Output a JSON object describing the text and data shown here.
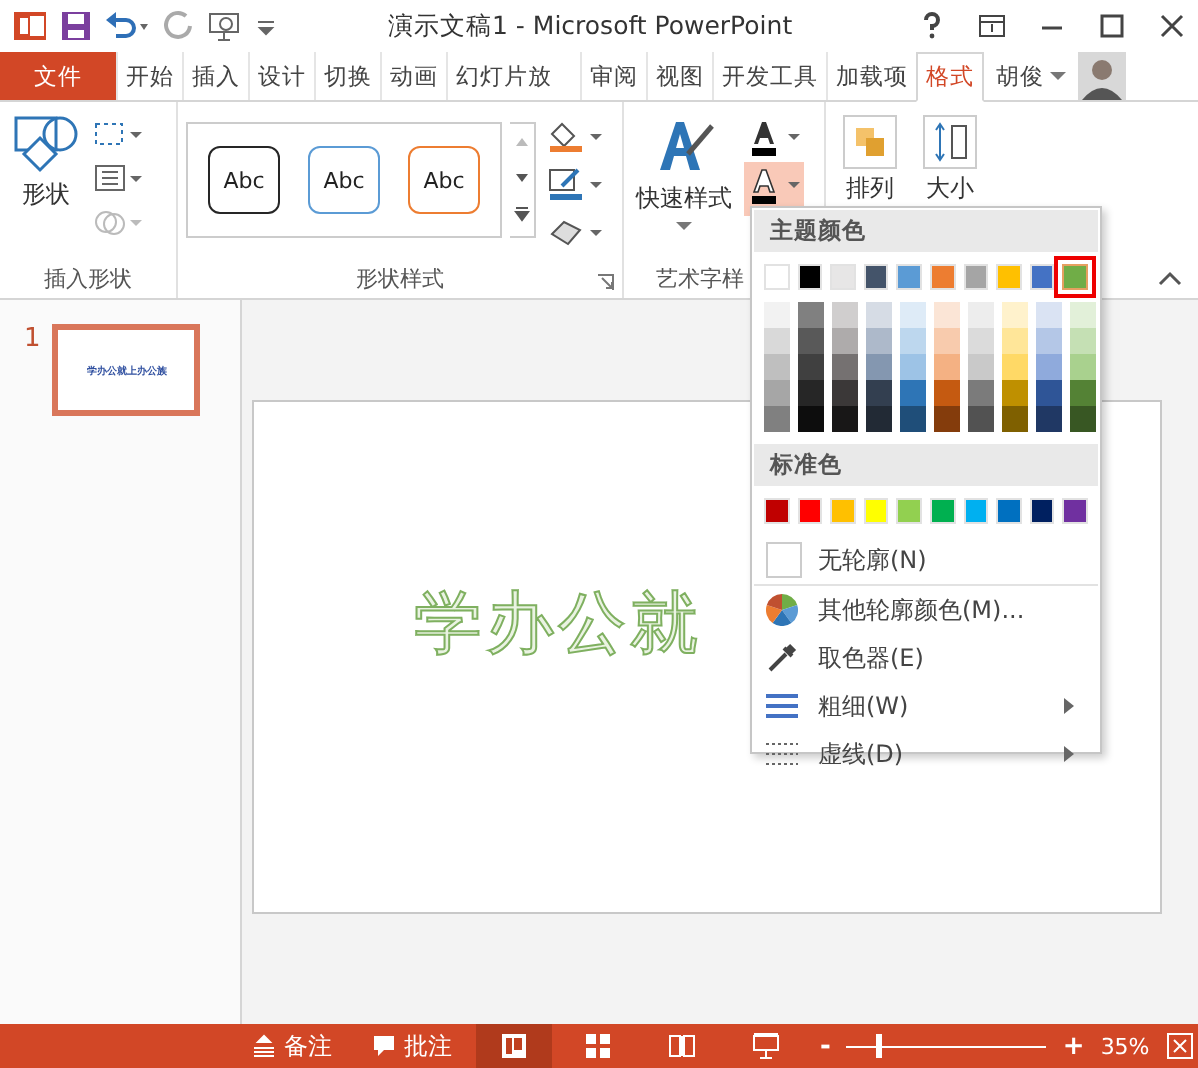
{
  "window": {
    "title": "演示文稿1 - Microsoft PowerPoint"
  },
  "tabs": [
    {
      "label": "文件",
      "kind": "file"
    },
    {
      "label": "开始",
      "kind": "tab",
      "selected": false
    },
    {
      "label": "插入",
      "kind": "tab",
      "selected": false
    },
    {
      "label": "设计",
      "kind": "tab",
      "selected": false
    },
    {
      "label": "切换",
      "kind": "tab",
      "selected": false
    },
    {
      "label": "动画",
      "kind": "tab",
      "selected": false
    },
    {
      "label": "幻灯片放",
      "kind": "tab",
      "selected": false
    },
    {
      "label": "审阅",
      "kind": "tab",
      "selected": false
    },
    {
      "label": "视图",
      "kind": "tab",
      "selected": false
    },
    {
      "label": "开发工具",
      "kind": "tab",
      "selected": false
    },
    {
      "label": "加载项",
      "kind": "tab",
      "selected": false
    },
    {
      "label": "格式",
      "kind": "tab",
      "selected": true
    }
  ],
  "user": {
    "name": "胡俊"
  },
  "ribbon": {
    "insert_shapes": {
      "label": "插入形状",
      "shapes_button": "形状"
    },
    "shape_styles": {
      "label": "形状样式",
      "samples": [
        {
          "text": "Abc",
          "color": "#262626"
        },
        {
          "text": "Abc",
          "color": "#5b9bd5"
        },
        {
          "text": "Abc",
          "color": "#ed7d31"
        }
      ]
    },
    "wordart_styles": {
      "label": "艺术字样",
      "quick_styles": "快速样式",
      "text_outline_expanded": true
    },
    "arrange": "排列",
    "size": "大小"
  },
  "thumbnails": [
    {
      "number": "1",
      "text": "学办公就上办公族",
      "selected": true
    }
  ],
  "slide": {
    "text": "学办公就"
  },
  "outline_menu": {
    "theme_heading": "主题颜色",
    "theme_colors": [
      {
        "color": "#ffffff",
        "selected": false
      },
      {
        "color": "#000000",
        "selected": false
      },
      {
        "color": "#e7e6e6",
        "selected": false
      },
      {
        "color": "#44546a",
        "selected": false
      },
      {
        "color": "#5b9bd5",
        "selected": false
      },
      {
        "color": "#ed7d31",
        "selected": false
      },
      {
        "color": "#a5a5a5",
        "selected": false
      },
      {
        "color": "#ffc000",
        "selected": false
      },
      {
        "color": "#4472c4",
        "selected": false
      },
      {
        "color": "#70ad47",
        "selected": true
      }
    ],
    "shades": [
      {
        "colors": [
          {
            "color": "#f2f2f2"
          },
          {
            "color": "#d9d9d9"
          },
          {
            "color": "#bfbfbf"
          },
          {
            "color": "#a6a6a6"
          },
          {
            "color": "#808080"
          }
        ]
      },
      {
        "colors": [
          {
            "color": "#808080"
          },
          {
            "color": "#595959"
          },
          {
            "color": "#404040"
          },
          {
            "color": "#262626"
          },
          {
            "color": "#0d0d0d"
          }
        ]
      },
      {
        "colors": [
          {
            "color": "#d0cece"
          },
          {
            "color": "#aeabab"
          },
          {
            "color": "#757171"
          },
          {
            "color": "#3b3838"
          },
          {
            "color": "#181717"
          }
        ]
      },
      {
        "colors": [
          {
            "color": "#d6dce5"
          },
          {
            "color": "#adb9ca"
          },
          {
            "color": "#8497b0"
          },
          {
            "color": "#333f50"
          },
          {
            "color": "#222a35"
          }
        ]
      },
      {
        "colors": [
          {
            "color": "#deebf7"
          },
          {
            "color": "#bdd7ee"
          },
          {
            "color": "#9dc3e6"
          },
          {
            "color": "#2e75b6"
          },
          {
            "color": "#1f4e79"
          }
        ]
      },
      {
        "colors": [
          {
            "color": "#fbe5d6"
          },
          {
            "color": "#f8cbad"
          },
          {
            "color": "#f4b183"
          },
          {
            "color": "#c55a11"
          },
          {
            "color": "#843c0c"
          }
        ]
      },
      {
        "colors": [
          {
            "color": "#ededed"
          },
          {
            "color": "#dbdbdb"
          },
          {
            "color": "#c9c9c9"
          },
          {
            "color": "#7b7b7b"
          },
          {
            "color": "#525252"
          }
        ]
      },
      {
        "colors": [
          {
            "color": "#fff2cc"
          },
          {
            "color": "#ffe699"
          },
          {
            "color": "#ffd966"
          },
          {
            "color": "#bf9000"
          },
          {
            "color": "#7f6000"
          }
        ]
      },
      {
        "colors": [
          {
            "color": "#dae3f3"
          },
          {
            "color": "#b4c7e7"
          },
          {
            "color": "#8faadc"
          },
          {
            "color": "#2f5597"
          },
          {
            "color": "#203864"
          }
        ]
      },
      {
        "colors": [
          {
            "color": "#e2f0d9"
          },
          {
            "color": "#c5e0b4"
          },
          {
            "color": "#a9d18e"
          },
          {
            "color": "#548235"
          },
          {
            "color": "#385723"
          }
        ]
      }
    ],
    "standard_heading": "标准色",
    "standard_colors": [
      {
        "color": "#c00000"
      },
      {
        "color": "#ff0000"
      },
      {
        "color": "#ffc000"
      },
      {
        "color": "#ffff00"
      },
      {
        "color": "#92d050"
      },
      {
        "color": "#00b050"
      },
      {
        "color": "#00b0f0"
      },
      {
        "color": "#0070c0"
      },
      {
        "color": "#002060"
      },
      {
        "color": "#7030a0"
      }
    ],
    "items": [
      {
        "kind": "none",
        "label": "无轮廓(N)"
      },
      {
        "kind": "more",
        "label": "其他轮廓颜色(M)..."
      },
      {
        "kind": "picker",
        "label": "取色器(E)"
      },
      {
        "kind": "weight",
        "label": "粗细(W)"
      },
      {
        "kind": "dashes",
        "label": "虚线(D)"
      }
    ]
  },
  "status_bar": {
    "notes": "备注",
    "comments": "批注",
    "views": [
      {
        "kind": "normal",
        "selected": true
      },
      {
        "kind": "sorter",
        "selected": false
      },
      {
        "kind": "reading",
        "selected": false
      },
      {
        "kind": "show",
        "selected": false
      }
    ],
    "zoom_out": "-",
    "zoom_in": "+",
    "zoom": {
      "level": 0.15,
      "reading": "35%"
    }
  }
}
